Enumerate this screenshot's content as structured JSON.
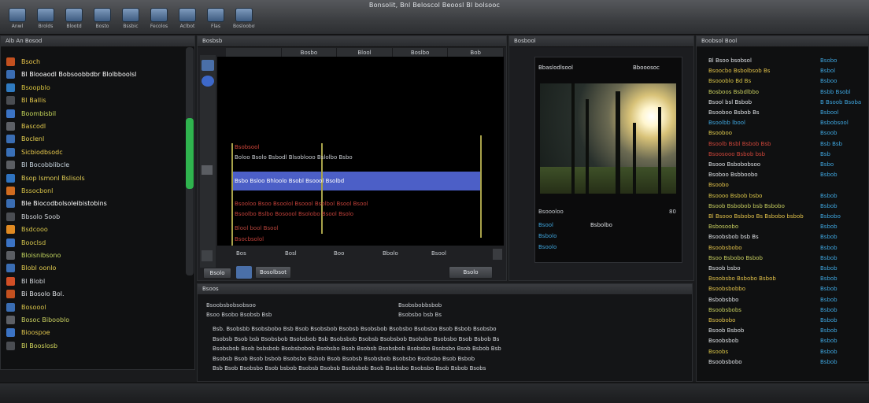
{
  "window": {
    "title": "Bonsolit, Bnl Beloscol Beoosl Bl bolsooc"
  },
  "toolbar": {
    "items": [
      {
        "label": "Anwl",
        "icon": "cloud-icon"
      },
      {
        "label": "Brolds",
        "icon": "grid-icon"
      },
      {
        "label": "Blootd",
        "icon": "folder-icon"
      },
      {
        "label": "Bosto",
        "icon": "brush-icon"
      },
      {
        "label": "Bssbic",
        "icon": "scissors-icon"
      },
      {
        "label": "Fecolos",
        "icon": "pen-icon"
      },
      {
        "label": "Aclbot",
        "icon": "monitor-icon"
      },
      {
        "label": "Flas",
        "icon": "person-icon"
      },
      {
        "label": "Bosloobot",
        "icon": "screen-icon"
      }
    ]
  },
  "library": {
    "title": "Alb An Bosod",
    "items": [
      {
        "label": "Bsoch",
        "color": "#e7c34a"
      },
      {
        "label": "Bl Blooaodl Bobsoobbdbr Blolbboolsl",
        "color": "#ffffff"
      },
      {
        "label": "Bsoopblo",
        "color": "#d9c43e"
      },
      {
        "label": "Bl Ballis",
        "color": "#e0c54a"
      },
      {
        "label": "Boombisbil",
        "color": "#c7d85a"
      },
      {
        "label": "Bascodl",
        "color": "#dfc74c"
      },
      {
        "label": "Boclenl",
        "color": "#e6d050"
      },
      {
        "label": "Sicbiodbsodc",
        "color": "#e8c94d"
      },
      {
        "label": "Bl Bocobblibcle",
        "color": "#c9d6e0"
      },
      {
        "label": "Bsop lsmonl Bslisols",
        "color": "#e2ce54"
      },
      {
        "label": "Bssocbonl",
        "color": "#d9c448"
      },
      {
        "label": "Ble Biocodbolsoleibistobins",
        "color": "#ffffff"
      },
      {
        "label": "Bbsolo Soob",
        "color": "#cfd3d8"
      },
      {
        "label": "Bsdcooo",
        "color": "#d7c54a"
      },
      {
        "label": "Booclsd",
        "color": "#d8c84e"
      },
      {
        "label": "Bloisnibsono",
        "color": "#c5d860"
      },
      {
        "label": "Blobl oonlo",
        "color": "#e0ca4e"
      },
      {
        "label": "Bl Blobl",
        "color": "#cfd3d8"
      },
      {
        "label": "Bi Bosolo Bol.",
        "color": "#dfe2e6"
      },
      {
        "label": "Bosoool",
        "color": "#d9c44a"
      },
      {
        "label": "Bosoc Bibooblo",
        "color": "#c9d060"
      },
      {
        "label": "Bioospoe",
        "color": "#e1c64e"
      },
      {
        "label": "Bl Booslosb",
        "color": "#d3d75c"
      }
    ]
  },
  "viewer": {
    "title": "Bosbsb",
    "tabs": [
      "",
      "Bosbo",
      "Blool",
      "Boslbo",
      "Bob"
    ],
    "lines": [
      {
        "text": "Bsobsool",
        "color": "#d0463a"
      },
      {
        "text": "Boloo Bsolo Bsbodl Blsoblooo Bslolbo Bsbo",
        "color": "#c9cdd2"
      },
      {
        "text": "Bsbo Bsloo Bhloolo Bsobl Bsoool Bsolbd",
        "color": "#ffffff"
      },
      {
        "text": "Bsooloo Bsoo Bsoolol Bsoool Bsolbol Bsool Bsool",
        "color": "#c2413a"
      },
      {
        "text": "Bsoolbo Bslbo Bosoool Bsolobo Bsool Bsolo",
        "color": "#c2413a"
      },
      {
        "text": "Blool bool Bsool",
        "color": "#b8463c"
      },
      {
        "text": "Bsocbsolol",
        "color": "#c2413a"
      }
    ],
    "footer": [
      "Bos",
      "Bosl",
      "Boo",
      "Bbolo",
      "Bsool"
    ],
    "bottom_left": "Bsolo",
    "bottom_btn": "Bosolbsot",
    "bottom_right": "Bsolo"
  },
  "inspector": {
    "title": "Bosbool",
    "header_left": "Bbaslodlsool",
    "header_right": "Bbooosoc",
    "meta_label": "Bsoooloo",
    "meta_num": "80",
    "rows": [
      "Bsool",
      "Bsbolo",
      "Bsoolo"
    ],
    "row_value": "Bsbolbo"
  },
  "properties": {
    "title": "Boobsol Bool",
    "rows": [
      {
        "k": "Bl Bsoo bsobsol",
        "v": "Bsobo",
        "kc": "#dfe2e6"
      },
      {
        "k": "Bsoocbo Bsbolbsob Bs",
        "v": "Bsbol",
        "kc": "#e2c24a"
      },
      {
        "k": "Bsoooblo Bd Bs",
        "v": "Bsboo",
        "kc": "#d9c448"
      },
      {
        "k": "Bosboos Bsbdlbbo",
        "v": "Bsbb Bsobl",
        "kc": "#c9d060"
      },
      {
        "k": "Bsool bsl Bsbob",
        "v": "B Bsoob Bsoba",
        "kc": "#dfe2e6"
      },
      {
        "k": "Bsooboo Bsbob Bs",
        "v": "Bsbool",
        "kc": "#dfe2e6"
      },
      {
        "k": "Bsoolbb lbool",
        "v": "Bsbobsool",
        "kc": "#3fa7e0"
      },
      {
        "k": "Bsooboo",
        "v": "Bsoob",
        "kc": "#e0ca4e"
      },
      {
        "k": "Bsoolb Bsbl Bsbob Bsb",
        "v": "Bsb Bsb",
        "kc": "#d0463a"
      },
      {
        "k": "Bsoosooo Bsbob bsb",
        "v": "Bsb",
        "kc": "#d0463a"
      },
      {
        "k": "Bsooo Bsbobobsoo",
        "v": "Bsbo",
        "kc": "#dfe2e6"
      },
      {
        "k": "Bsoboo Bsbboobo",
        "v": "Bsbob",
        "kc": "#dfe2e6"
      },
      {
        "k": "Bsoobo",
        "v": "",
        "kc": "#e2c24a"
      },
      {
        "k": "Bsoooo Bsbob bsbo",
        "v": "Bsbob",
        "kc": "#d9c448"
      },
      {
        "k": "Bsoob Bsbobob bsb Bsbobo",
        "v": "Bsbob",
        "kc": "#c9d060"
      },
      {
        "k": "Bl Bsooo Bsbobo Bs Bsbobo bsbob",
        "v": "Bsbobo",
        "kc": "#e2c24a"
      },
      {
        "k": "Bsbosoobo",
        "v": "Bsbob",
        "kc": "#c9d060"
      },
      {
        "k": "Bsoobsbob bsb Bs",
        "v": "Bsbob",
        "kc": "#dfe2e6"
      },
      {
        "k": "Bsoobsbobo",
        "v": "Bsbob",
        "kc": "#e2c24a"
      },
      {
        "k": "Bsoo Bsbobo Bsbob",
        "v": "Bsbob",
        "kc": "#c9d060"
      },
      {
        "k": "Bsoob bsbo",
        "v": "Bsbob",
        "kc": "#dfe2e6"
      },
      {
        "k": "Bsoobsbo Bsbobo Bsbob",
        "v": "Bsbob",
        "kc": "#e2c24a"
      },
      {
        "k": "Bsoobsbobbo",
        "v": "Bsbob",
        "kc": "#e2c24a"
      },
      {
        "k": "Bsbobsbbo",
        "v": "Bsbob",
        "kc": "#dfe2e6"
      },
      {
        "k": "Bsoobsbobs",
        "v": "Bsbob",
        "kc": "#c9d060"
      },
      {
        "k": "Bsoobobo",
        "v": "Bsbob",
        "kc": "#e2c24a"
      },
      {
        "k": "Bsoob Bsbob",
        "v": "Bsbob",
        "kc": "#dfe2e6"
      },
      {
        "k": "Bsoobsbob",
        "v": "Bsbob",
        "kc": "#dfe2e6"
      },
      {
        "k": "Bsoobs",
        "v": "Bsbob",
        "kc": "#d9c448"
      },
      {
        "k": "Bsoobsbobo",
        "v": "Bsbob",
        "kc": "#dfe2e6"
      }
    ]
  },
  "timeline": {
    "title": "Bsoos",
    "header_left": "Bsoobsbobsobsoo",
    "header_mid": "Bsobsbobbsbob",
    "sub_left": "Bsoo Bsobo Bsobsb Bsb",
    "sub_mid": "Bsobsbo bsb Bs",
    "rows": [
      "Bsb. Bsobsbb Bsobsbobo Bsb Bsob  Bsobsbob Bsobsb Bsobsbob Bsobsbo Bsobsbo Bsob Bsbob Bsobsbo",
      "Bsobsb Bsob bsb Bsobsbob Bsobsbob Bsb  Bsobsbob Bsobsb Bsobsbob Bsobsbo Bsobsbo Bsob Bsbob Bs",
      "Bsobsbob Bsob bsbsbob Bsobsbobob Bsobsbo  Bsob Bsobsb Bsobsbob Bsobsbo Bsobsbo Bsob Bsbob Bsb",
      "Bsobsb Bsob Bsob bsbob Bsobsbo Bsbob  Bsob Bsobsb Bsobsbob Bsobsbo Bsobsbo Bsob Bsbob",
      "Bsb Bsob Bsobsbo Bsob bsbob Bsobsb  Bsobsb Bsobsbob Bsob Bsobsbo Bsobsbo Bsob Bsbob Bsobs"
    ]
  }
}
